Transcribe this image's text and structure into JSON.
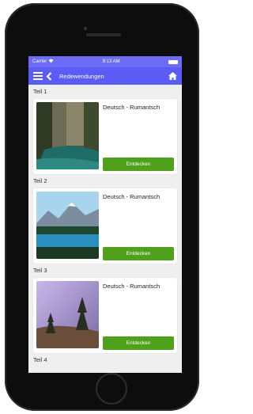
{
  "status": {
    "carrier": "Carrier",
    "time": "9:13 AM"
  },
  "nav": {
    "title": "Redewendungen"
  },
  "sections": [
    {
      "label": "Teil 1",
      "title": "Deutsch - Rumantsch",
      "button": "Entdecken"
    },
    {
      "label": "Teil 2",
      "title": "Deutsch - Rumantsch",
      "button": "Entdecken"
    },
    {
      "label": "Teil 3",
      "title": "Deutsch - Rumantsch",
      "button": "Entdecken"
    },
    {
      "label": "Teil 4"
    }
  ],
  "colors": {
    "navbar": "#5b5bf5",
    "button": "#4fa01b"
  }
}
